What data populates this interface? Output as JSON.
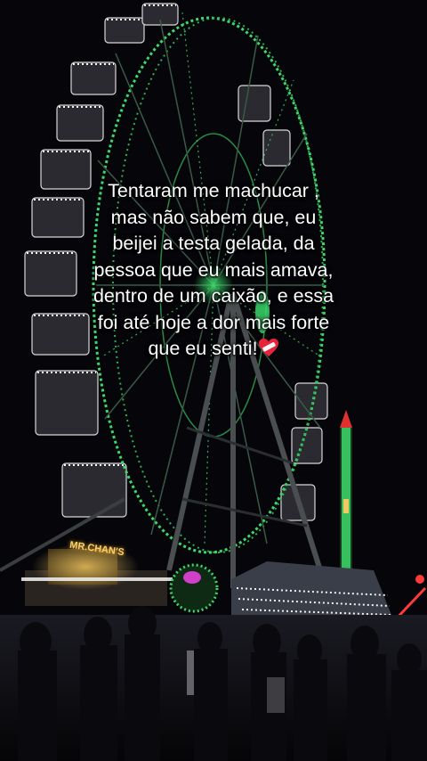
{
  "caption": {
    "lines": [
      "Tentaram me machucar ,",
      "mas não sabem que, eu",
      "beijei a testa gelada, da",
      "pessoa que eu mais amava,",
      "dentro de um caixão, e essa",
      "foi até hoje a dor mais forte",
      "que eu senti!"
    ],
    "emoji": "heart-bandage-icon"
  },
  "scene": {
    "subject": "ferris-wheel",
    "sign_text": "MR.CHAN'S",
    "colors": {
      "sky": "#06060a",
      "wheel_lights": "#3cd86a",
      "cabin_lights": "#e8e8e8",
      "warm_lights": "#f3c860",
      "magenta_light": "#d040c8",
      "red_light": "#ff3a3a"
    }
  }
}
